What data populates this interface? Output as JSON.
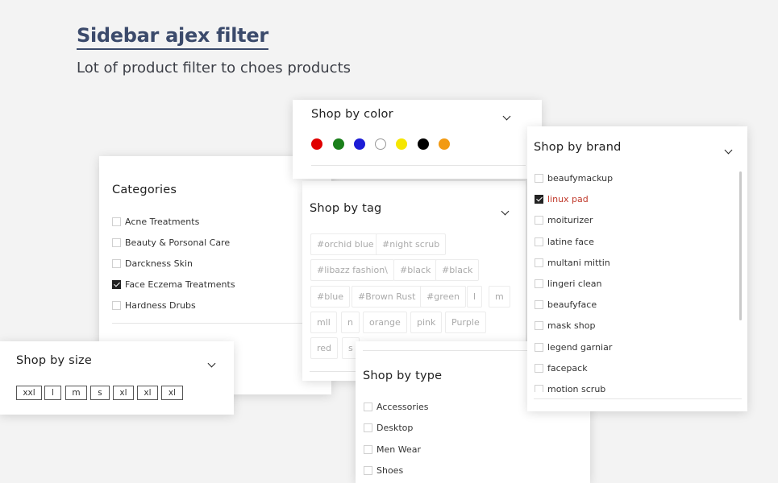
{
  "hero": {
    "title": "Sidebar ajex filter",
    "subtitle": "Lot of product filter to choes products"
  },
  "categories": {
    "title": "Categories",
    "items": [
      {
        "label": "Acne Treatments",
        "checked": false
      },
      {
        "label": "Beauty & Porsonal Care",
        "checked": false
      },
      {
        "label": "Darckness Skin",
        "checked": false
      },
      {
        "label": "Face Eczema Treatments",
        "checked": true
      },
      {
        "label": "Hardness Drubs",
        "checked": false
      }
    ]
  },
  "color": {
    "title": "Shop by color",
    "swatches": [
      "#e00000",
      "#1a7f1a",
      "#1c1cd6",
      "#ffffff",
      "#f5e600",
      "#000000",
      "#f29a12"
    ]
  },
  "tag": {
    "title": "Shop by tag",
    "tags": [
      "#orchid blue",
      "#night scrub",
      "#libazz fashion\\",
      "#black",
      "#black",
      "#blue",
      "#Brown Rust",
      "#green",
      "l",
      "m",
      "mll",
      "n",
      "orange",
      "pink",
      "Purple",
      "red",
      "s"
    ]
  },
  "brand": {
    "title": "Shop by brand",
    "items": [
      {
        "label": "beaufymackup",
        "checked": false
      },
      {
        "label": "linux pad",
        "checked": true
      },
      {
        "label": "moiturizer",
        "checked": false
      },
      {
        "label": "latine face",
        "checked": false
      },
      {
        "label": "multani mittin",
        "checked": false
      },
      {
        "label": "lingeri clean",
        "checked": false
      },
      {
        "label": "beaufyface",
        "checked": false
      },
      {
        "label": "mask shop",
        "checked": false
      },
      {
        "label": "legend garniar",
        "checked": false
      },
      {
        "label": "facepack",
        "checked": false
      },
      {
        "label": "motion scrub",
        "checked": false
      }
    ],
    "active_color": "#c0392b"
  },
  "size": {
    "title": "Shop by size",
    "sizes": [
      "xxl",
      "l",
      "m",
      "s",
      "xl",
      "xl",
      "xl"
    ]
  },
  "type": {
    "title": "Shop by type",
    "items": [
      {
        "label": "Accessories",
        "checked": false
      },
      {
        "label": "Desktop",
        "checked": false
      },
      {
        "label": "Men Wear",
        "checked": false
      },
      {
        "label": "Shoes",
        "checked": false
      }
    ]
  }
}
